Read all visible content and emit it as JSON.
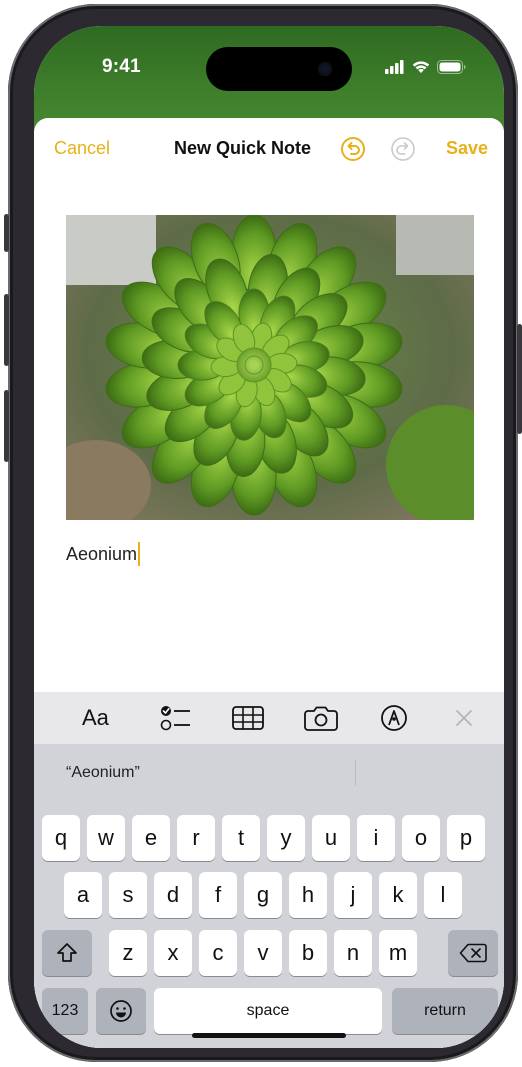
{
  "status_bar": {
    "time": "9:41"
  },
  "navbar": {
    "cancel": "Cancel",
    "title": "New Quick Note",
    "save": "Save"
  },
  "note": {
    "text": "Aeonium"
  },
  "toolbar": {
    "format_label": "Aa"
  },
  "suggestions": {
    "first": "“Aeonium”"
  },
  "keyboard": {
    "row1": [
      "q",
      "w",
      "e",
      "r",
      "t",
      "y",
      "u",
      "i",
      "o",
      "p"
    ],
    "row2": [
      "a",
      "s",
      "d",
      "f",
      "g",
      "h",
      "j",
      "k",
      "l"
    ],
    "row3": [
      "z",
      "x",
      "c",
      "v",
      "b",
      "n",
      "m"
    ],
    "numbers_key": "123",
    "space_key": "space",
    "return_key": "return"
  },
  "colors": {
    "accent": "#e8b019",
    "keyboard_bg": "#d1d3d9",
    "wallpaper": "#3f7f2b"
  }
}
